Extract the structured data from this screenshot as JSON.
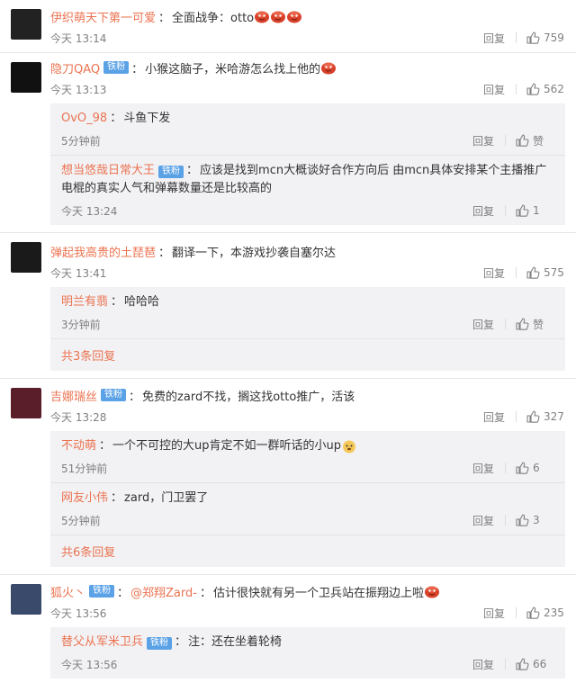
{
  "reply_label": "回复",
  "comments": [
    {
      "user": "伊织萌天下第一可爱",
      "badge": "",
      "text": "全面战争：otto",
      "emojis": 3,
      "time": "今天 13:14",
      "likes": "759",
      "replies": [],
      "more": ""
    },
    {
      "user": "隐刀QAQ",
      "badge": "铁粉",
      "text": "小猴这脑子，米哈游怎么找上他的",
      "emojis": 1,
      "time": "今天 13:13",
      "likes": "562",
      "replies": [
        {
          "user": "OvO_98",
          "badge": "",
          "text": "斗鱼下发",
          "time": "5分钟前",
          "likes": "赞"
        },
        {
          "user": "想当悠哉日常大王",
          "badge": "铁粉",
          "text": "应该是找到mcn大概谈好合作方向后 由mcn具体安排某个主播推广电棍的真实人气和弹幕数量还是比较高的",
          "time": "今天 13:24",
          "likes": "1"
        }
      ],
      "more": ""
    },
    {
      "user": "弹起我高贵的土琵琶",
      "badge": "",
      "text": "翻译一下，本游戏抄袭自塞尔达",
      "emojis": 0,
      "time": "今天 13:41",
      "likes": "575",
      "replies": [
        {
          "user": "明兰有翡",
          "badge": "",
          "text": "哈哈哈",
          "time": "3分钟前",
          "likes": "赞"
        }
      ],
      "more": "共3条回复"
    },
    {
      "user": "吉娜瑞丝",
      "badge": "铁粉",
      "text": "免费的zard不找，搁这找otto推广，活该",
      "emojis": 0,
      "time": "今天 13:28",
      "likes": "327",
      "replies": [
        {
          "user": "不动萌",
          "badge": "",
          "text": "一个不可控的大up肯定不如一群听话的小up",
          "time": "51分钟前",
          "likes": "6"
        },
        {
          "user": "网友小伟",
          "badge": "",
          "text": "zard，门卫罢了",
          "time": "5分钟前",
          "likes": "3"
        }
      ],
      "more": "共6条回复"
    },
    {
      "user": "狐火丶",
      "badge": "铁粉",
      "mention": "@郑翔Zard-",
      "text": "估计很快就有另一个卫兵站在振翔边上啦",
      "emojis": 1,
      "time": "今天 13:56",
      "likes": "235",
      "replies": [
        {
          "user": "替父从军米卫兵",
          "badge": "铁粉",
          "text": "注：还在坐着轮椅",
          "time": "今天 13:56",
          "likes": "66"
        }
      ],
      "more": ""
    }
  ],
  "colors": {
    "username": "#eb7350",
    "badge": "#5aa1e6",
    "meta": "#808080",
    "sub_bg": "#f2f2f5"
  }
}
